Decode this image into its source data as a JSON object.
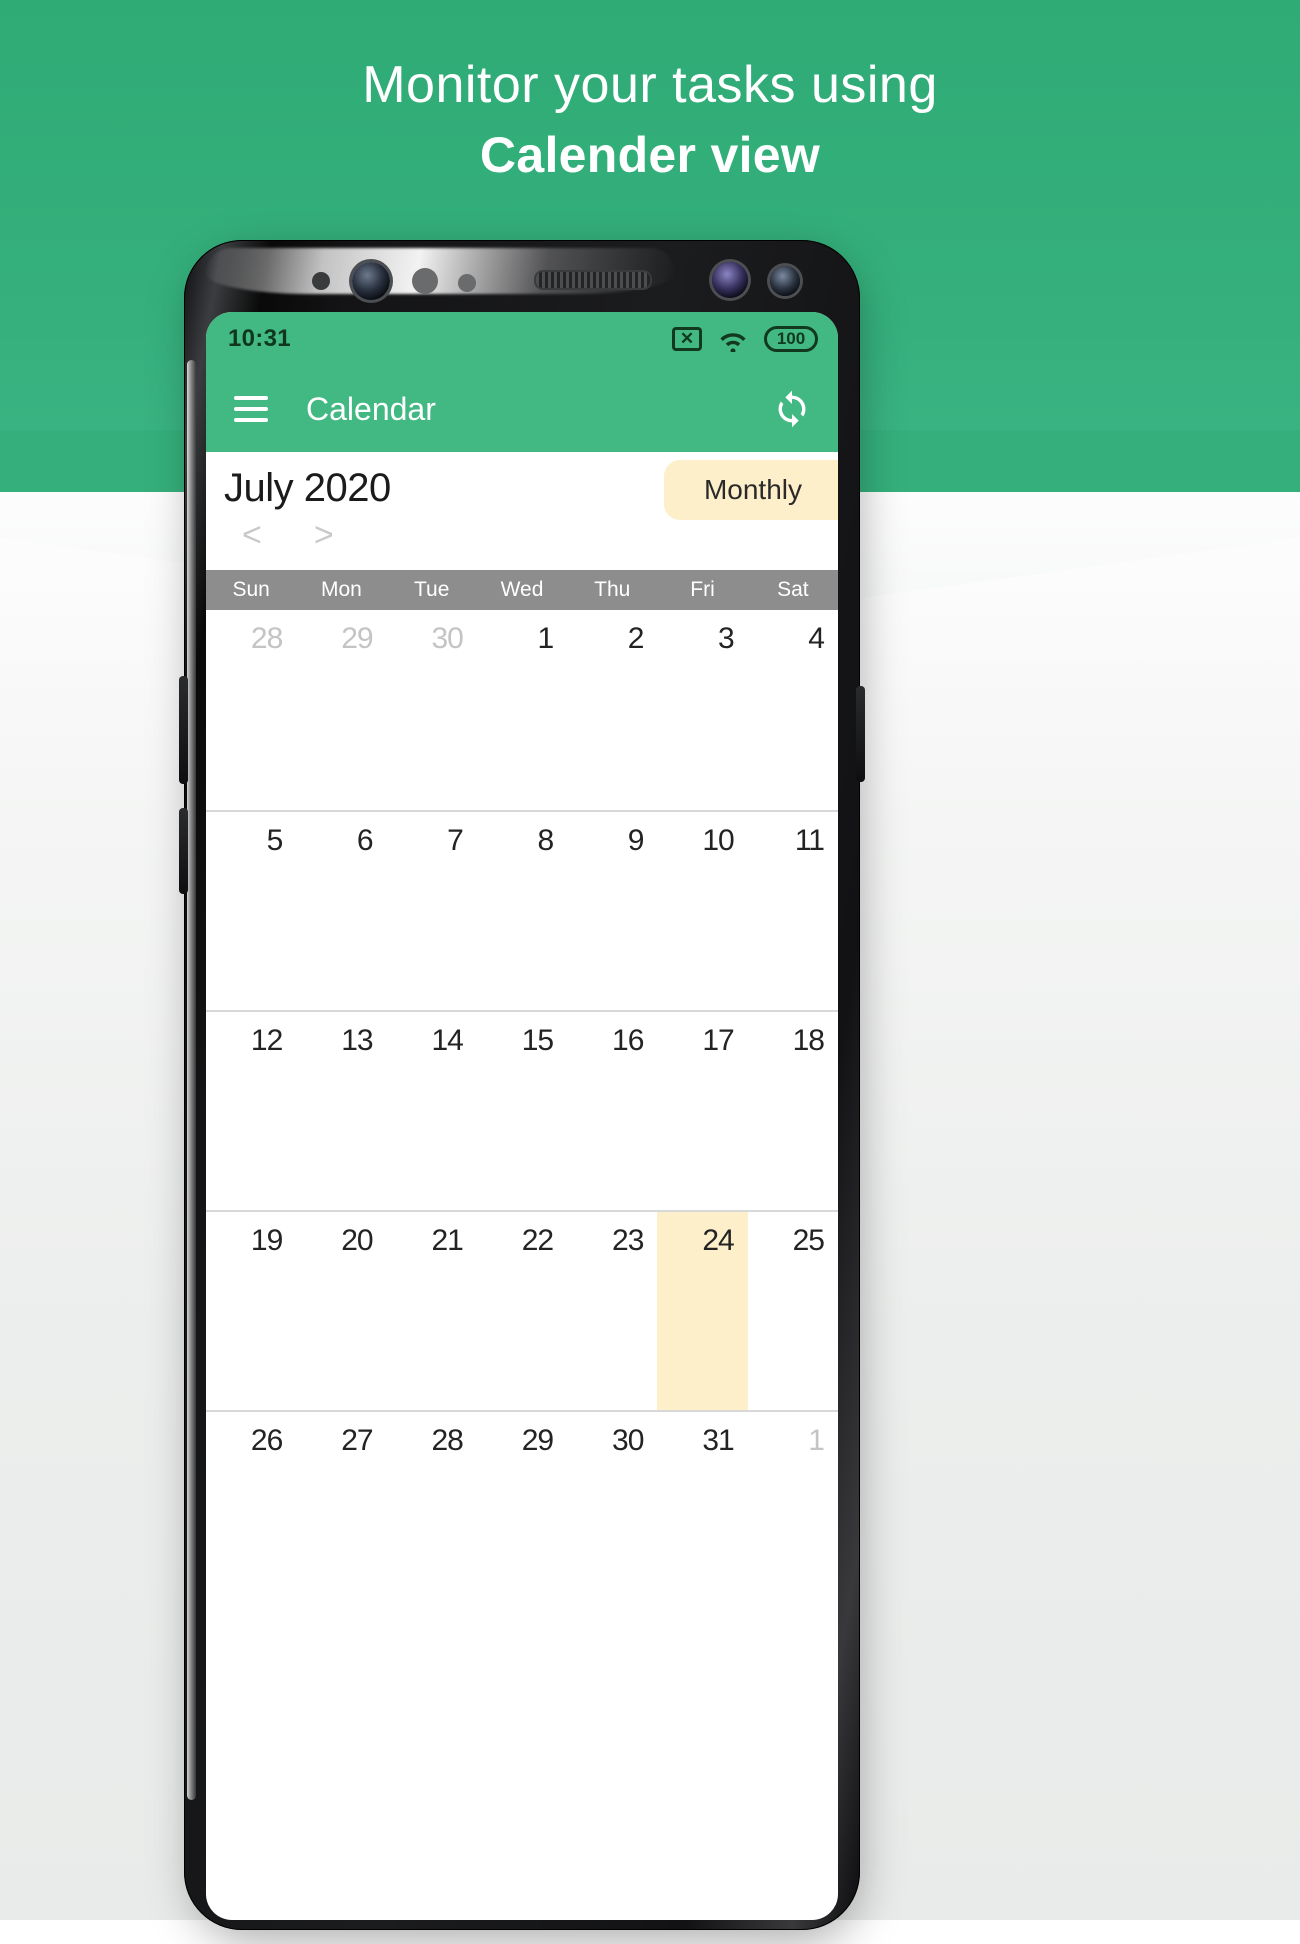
{
  "promo": {
    "headline_line1": "Monitor your tasks using",
    "headline_line2": "Calender view",
    "brand_green": "#35b07c",
    "accent_cream": "#fdefc9"
  },
  "status_bar": {
    "time": "10:31",
    "nosim_icon": "no-sim-icon",
    "nosim_glyph": "✕",
    "wifi_icon": "wifi-icon",
    "battery_icon": "battery-icon",
    "battery_level": "100"
  },
  "app_bar": {
    "menu_icon": "hamburger-menu-icon",
    "title": "Calendar",
    "sync_icon": "sync-refresh-icon"
  },
  "calendar": {
    "month_title": "July 2020",
    "prev_label": "<",
    "next_label": ">",
    "view_mode": "Monthly",
    "weekdays": [
      "Sun",
      "Mon",
      "Tue",
      "Wed",
      "Thu",
      "Fri",
      "Sat"
    ],
    "today": 24,
    "weeks": [
      [
        {
          "d": "28",
          "other": true
        },
        {
          "d": "29",
          "other": true
        },
        {
          "d": "30",
          "other": true
        },
        {
          "d": "1",
          "other": false
        },
        {
          "d": "2",
          "other": false
        },
        {
          "d": "3",
          "other": false
        },
        {
          "d": "4",
          "other": false
        }
      ],
      [
        {
          "d": "5",
          "other": false
        },
        {
          "d": "6",
          "other": false
        },
        {
          "d": "7",
          "other": false
        },
        {
          "d": "8",
          "other": false
        },
        {
          "d": "9",
          "other": false
        },
        {
          "d": "10",
          "other": false
        },
        {
          "d": "11",
          "other": false
        }
      ],
      [
        {
          "d": "12",
          "other": false
        },
        {
          "d": "13",
          "other": false
        },
        {
          "d": "14",
          "other": false
        },
        {
          "d": "15",
          "other": false
        },
        {
          "d": "16",
          "other": false
        },
        {
          "d": "17",
          "other": false
        },
        {
          "d": "18",
          "other": false
        }
      ],
      [
        {
          "d": "19",
          "other": false
        },
        {
          "d": "20",
          "other": false
        },
        {
          "d": "21",
          "other": false
        },
        {
          "d": "22",
          "other": false
        },
        {
          "d": "23",
          "other": false
        },
        {
          "d": "24",
          "other": false,
          "today": true
        },
        {
          "d": "25",
          "other": false
        }
      ],
      [
        {
          "d": "26",
          "other": false
        },
        {
          "d": "27",
          "other": false
        },
        {
          "d": "28",
          "other": false
        },
        {
          "d": "29",
          "other": false
        },
        {
          "d": "30",
          "other": false
        },
        {
          "d": "31",
          "other": false
        },
        {
          "d": "1",
          "other": true
        }
      ]
    ]
  }
}
